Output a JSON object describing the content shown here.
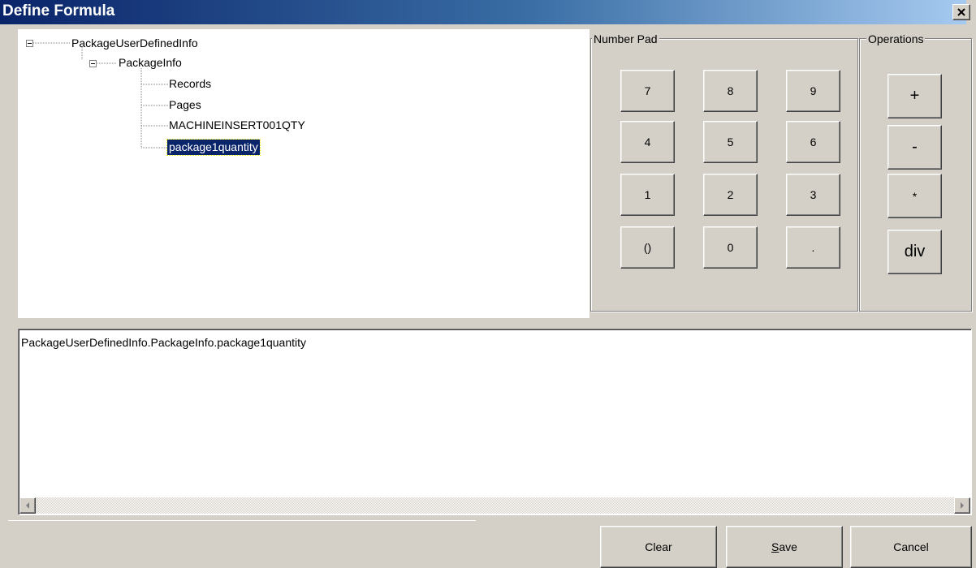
{
  "window": {
    "title": "Define Formula"
  },
  "tree": {
    "root": "PackageUserDefinedInfo",
    "child": "PackageInfo",
    "leaves": [
      "Records",
      "Pages",
      "MACHINEINSERT001QTY",
      "package1quantity"
    ],
    "selected_index": 3
  },
  "number_pad": {
    "label": "Number Pad",
    "keys": [
      "7",
      "8",
      "9",
      "4",
      "5",
      "6",
      "1",
      "2",
      "3",
      "()",
      "0",
      "."
    ]
  },
  "operations": {
    "label": "Operations",
    "keys": [
      "+",
      "-",
      "*",
      "div"
    ]
  },
  "formula": {
    "text": "PackageUserDefinedInfo.PackageInfo.package1quantity"
  },
  "footer": {
    "clear_label": "Clear",
    "save_prefix": "",
    "save_accel": "S",
    "save_rest": "ave",
    "cancel_label": "Cancel"
  },
  "colors": {
    "title_gradient_start": "#0a246a",
    "title_gradient_end": "#a6caf0",
    "selection_bg": "#0a246a",
    "face": "#d4d0c8"
  }
}
